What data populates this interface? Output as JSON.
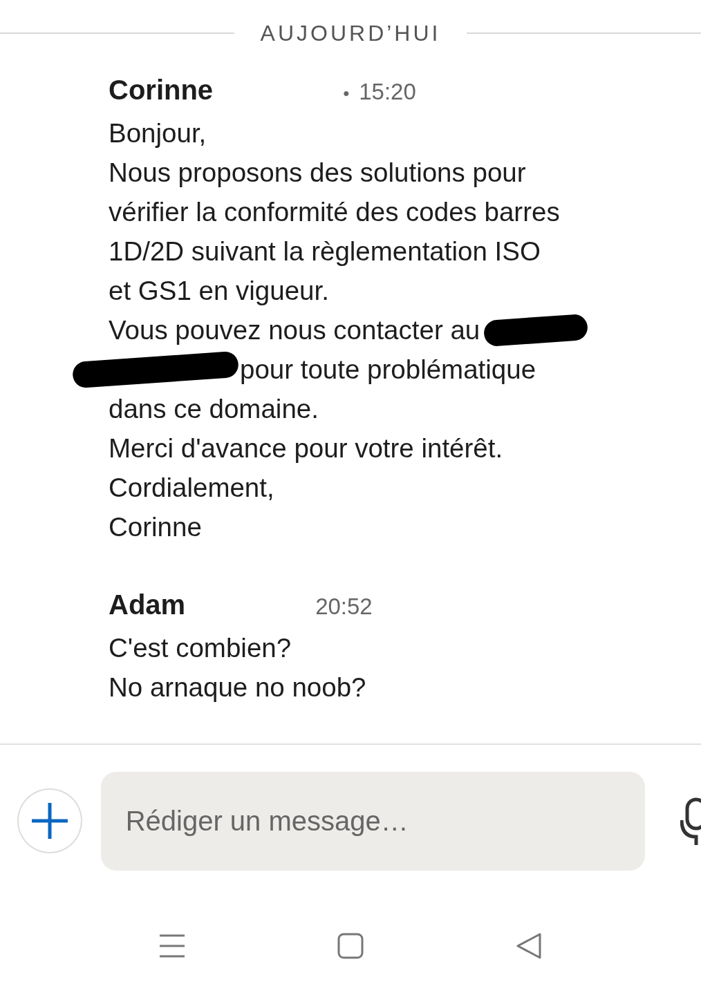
{
  "day_divider": "AUJOURD’HUI",
  "messages": [
    {
      "sender": "Corinne",
      "separator": "•",
      "time": "15:20",
      "lines": [
        {
          "text": "Bonjour,",
          "redacted_before": false,
          "redacted_after": false
        },
        {
          "text": "Nous proposons des solutions pour",
          "redacted_before": false,
          "redacted_after": false
        },
        {
          "text": "vérifier la conformité des codes barres",
          "redacted_before": false,
          "redacted_after": false
        },
        {
          "text": "1D/2D suivant la règlementation ISO",
          "redacted_before": false,
          "redacted_after": false
        },
        {
          "text": "et GS1 en vigueur.",
          "redacted_before": false,
          "redacted_after": false
        },
        {
          "text": "Vous pouvez nous contacter au",
          "redacted_before": false,
          "redacted_after": true
        },
        {
          "text": "pour toute problématique",
          "redacted_before": true,
          "redacted_after": false
        },
        {
          "text": "dans ce domaine.",
          "redacted_before": false,
          "redacted_after": false
        },
        {
          "text": "Merci d'avance pour votre intérêt.",
          "redacted_before": false,
          "redacted_after": false
        },
        {
          "text": "Cordialement,",
          "redacted_before": false,
          "redacted_after": false
        },
        {
          "text": "Corinne",
          "redacted_before": false,
          "redacted_after": false
        }
      ]
    },
    {
      "sender": "Adam",
      "time": "20:52",
      "lines": [
        {
          "text": "C'est combien?",
          "redacted_before": false,
          "redacted_after": false
        },
        {
          "text": "No arnaque no noob?",
          "redacted_before": false,
          "redacted_after": false
        }
      ]
    }
  ],
  "composer": {
    "placeholder": "Rédiger un message…"
  }
}
